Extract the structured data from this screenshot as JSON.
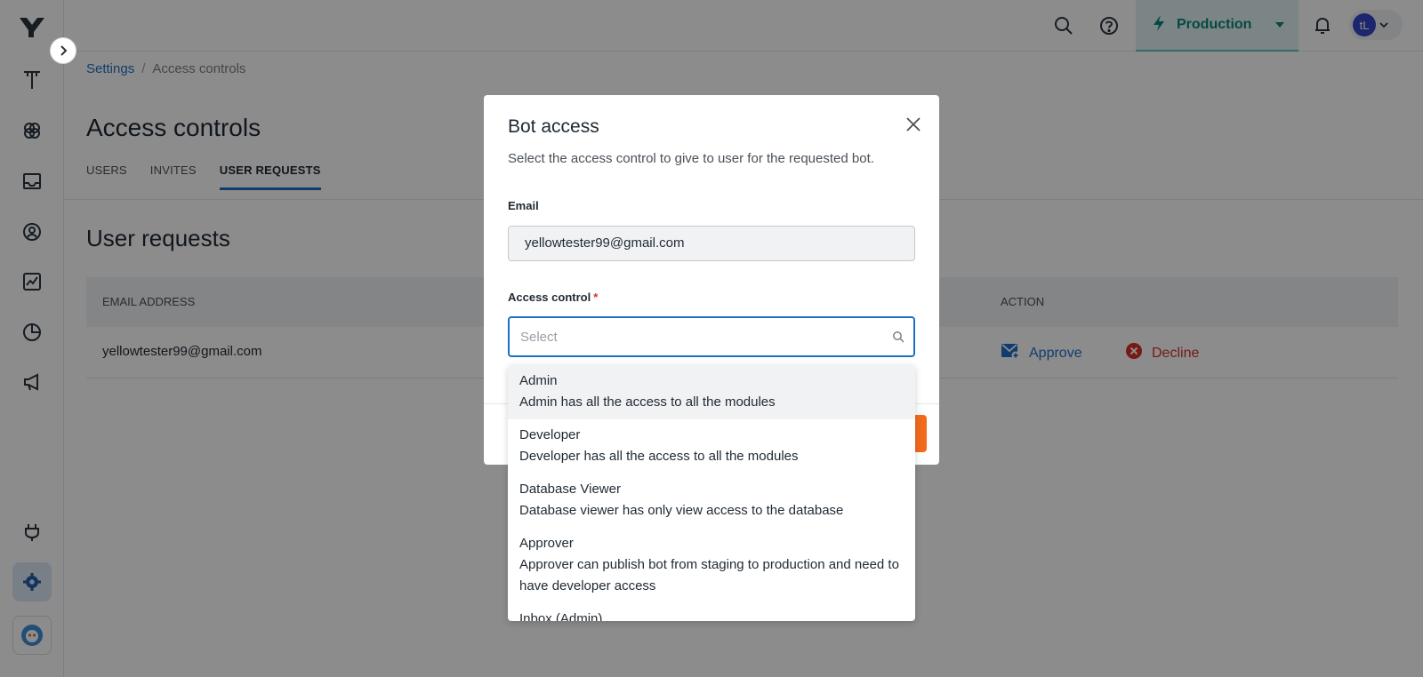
{
  "topbar": {
    "environment": "Production",
    "avatar_initials": "tL",
    "env_color": "#0d8378"
  },
  "breadcrumb": {
    "parent": "Settings",
    "separator": "/",
    "current": "Access controls"
  },
  "page": {
    "title": "Access controls",
    "tabs": [
      {
        "label": "USERS",
        "active": false
      },
      {
        "label": "INVITES",
        "active": false
      },
      {
        "label": "USER REQUESTS",
        "active": true
      }
    ],
    "section_title": "User requests"
  },
  "table": {
    "headers": {
      "email": "EMAIL ADDRESS",
      "action": "ACTION"
    },
    "rows": [
      {
        "email": "yellowtester99@gmail.com",
        "approve": "Approve",
        "decline": "Decline"
      }
    ]
  },
  "modal": {
    "title": "Bot access",
    "description": "Select the access control to give to user for the requested bot.",
    "email_label": "Email",
    "email_value": "yellowtester99@gmail.com",
    "access_label": "Access control",
    "required_mark": "*",
    "select_placeholder": "Select"
  },
  "dropdown": {
    "options": [
      {
        "name": "Admin",
        "desc": "Admin has all the access to all the modules"
      },
      {
        "name": "Developer",
        "desc": "Developer has all the access to all the modules"
      },
      {
        "name": "Database Viewer",
        "desc": "Database viewer has only view access to the database"
      },
      {
        "name": "Approver",
        "desc": "Approver can publish bot from staging to production and need to have developer access"
      },
      {
        "name": "Inbox (Admin)",
        "desc": ""
      }
    ]
  },
  "colors": {
    "primary_blue": "#1f6fc8",
    "accent_orange": "#f26b1d",
    "decline_red": "#d6302b"
  },
  "icons": [
    "logo-icon",
    "sidebar-toggle-icon",
    "studio-icon",
    "brain-icon",
    "inbox-icon",
    "users-icon",
    "analytics-icon",
    "pie-chart-icon",
    "megaphone-icon",
    "plug-icon",
    "settings-icon",
    "bot-icon",
    "search-icon",
    "help-icon",
    "lightning-icon",
    "chevron-down-icon",
    "bell-icon",
    "close-icon",
    "approve-icon",
    "decline-icon"
  ]
}
